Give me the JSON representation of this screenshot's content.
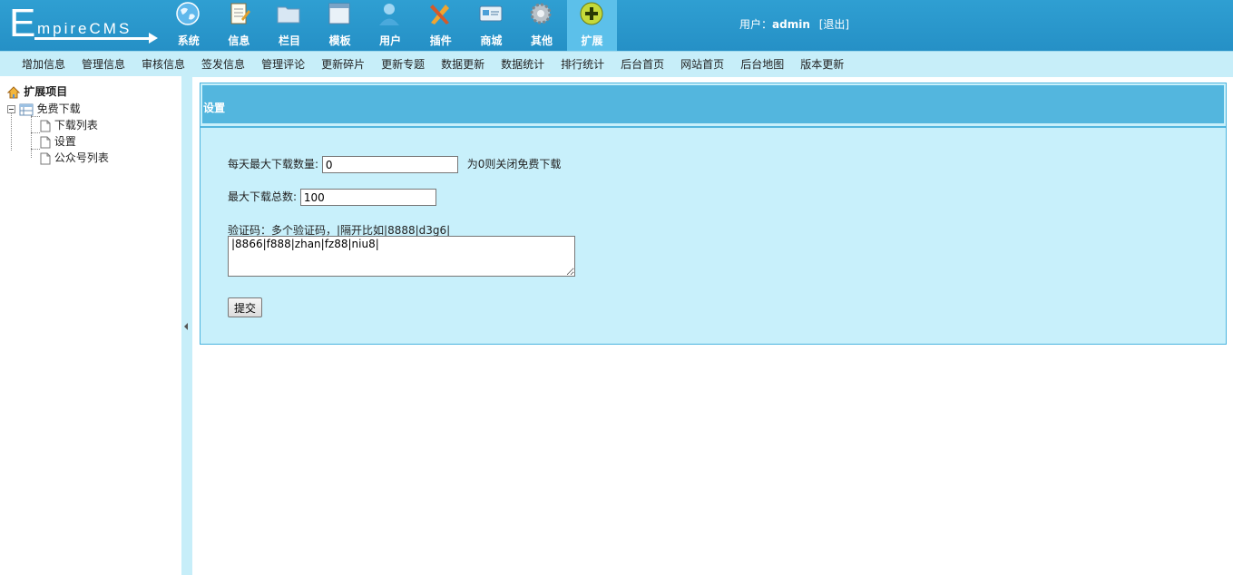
{
  "logo": {
    "first_letter": "E",
    "rest": "mpireCMS"
  },
  "nav": [
    {
      "label": "系统",
      "icon": "globe-icon"
    },
    {
      "label": "信息",
      "icon": "notepad-icon"
    },
    {
      "label": "栏目",
      "icon": "folder-icon"
    },
    {
      "label": "模板",
      "icon": "window-template-icon"
    },
    {
      "label": "用户",
      "icon": "user-icon"
    },
    {
      "label": "插件",
      "icon": "tools-icon"
    },
    {
      "label": "商城",
      "icon": "card-icon"
    },
    {
      "label": "其他",
      "icon": "gear-icon"
    },
    {
      "label": "扩展",
      "icon": "plus-circle-icon",
      "active": true
    }
  ],
  "user": {
    "prefix": "用户：",
    "name": "admin",
    "logout": "[退出]"
  },
  "submenu": [
    "增加信息",
    "管理信息",
    "审核信息",
    "签发信息",
    "管理评论",
    "更新碎片",
    "更新专题",
    "数据更新",
    "数据统计",
    "排行统计",
    "后台首页",
    "网站首页",
    "后台地图",
    "版本更新"
  ],
  "tree": {
    "root": "扩展项目",
    "folder": "免费下载",
    "children": [
      "下载列表",
      "设置",
      "公众号列表"
    ]
  },
  "panel": {
    "title": "设置",
    "daily_label": "每天最大下载数量:",
    "daily_value": "0",
    "daily_hint": "为0则关闭免费下载",
    "total_label": "最大下载总数:",
    "total_value": "100",
    "captcha_label": "验证码：多个验证码，|隔开比如|8888|d3g6|",
    "captcha_value": "|8866|f888|zhan|fz88|niu8|",
    "submit": "提交"
  },
  "colors": {
    "header": "#2590c6",
    "accent": "#53b6de",
    "panel_bg": "#c8f0fb",
    "submenu_bg": "#c7eef9"
  }
}
